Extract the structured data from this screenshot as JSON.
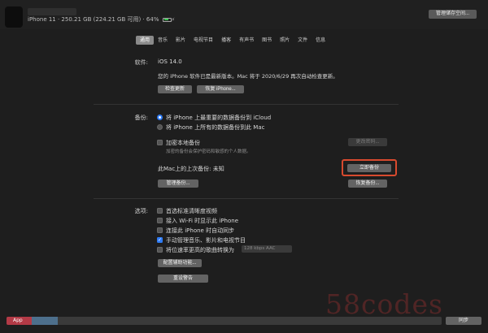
{
  "header": {
    "device_info": "iPhone 11 · 250.21 GB (224.21 GB 可用) · 64%",
    "manage_storage_label": "管理储存空间..."
  },
  "tabs": [
    "通用",
    "音乐",
    "影片",
    "电视节目",
    "播客",
    "有声书",
    "图书",
    "照片",
    "文件",
    "信息"
  ],
  "active_tab": "通用",
  "software": {
    "label": "软件:",
    "version": "iOS 14.0",
    "status": "您的 iPhone 软件已是最新版本。Mac 将于 2020/6/29 再次自动检查更新。",
    "check_update_label": "检查更新",
    "restore_label": "恢复 iPhone..."
  },
  "backup": {
    "label": "备份:",
    "option_icloud": "将 iPhone 上最重要的数据备份到 iCloud",
    "option_mac": "将 iPhone 上所有的数据备份到此 Mac",
    "encrypt_label": "加密本地备份",
    "encrypt_note": "加密的备份会保护密码和敏感的个人数据。",
    "change_password_label": "更改密码...",
    "last_backup": "此Mac上的上次备份: 未知",
    "backup_now_label": "立即备份",
    "manage_backups_label": "管理备份...",
    "restore_backup_label": "恢复备份..."
  },
  "options": {
    "label": "选项:",
    "items": [
      {
        "text": "首选标准清晰度视频",
        "checked": false
      },
      {
        "text": "接入 Wi-Fi 时显示此 iPhone",
        "checked": false
      },
      {
        "text": "连接此 iPhone 时自动同步",
        "checked": false
      },
      {
        "text": "手动管理音乐、影片和电视节目",
        "checked": true
      },
      {
        "text": "将位速率更高的歌曲转换为",
        "checked": false
      }
    ],
    "bitrate_value": "128 kbps AAC",
    "accessibility_label": "配置辅助功能...",
    "reset_warnings_label": "重设警告"
  },
  "storage": {
    "app_label": "App",
    "segments": {
      "app_fraction": 0.058,
      "blue_fraction": 0.06
    }
  },
  "sync_label": "同步",
  "watermark": "58codes",
  "colors": {
    "accent": "#2f7cf6",
    "highlight": "#d84a2e",
    "app_segment": "#b33a46"
  }
}
